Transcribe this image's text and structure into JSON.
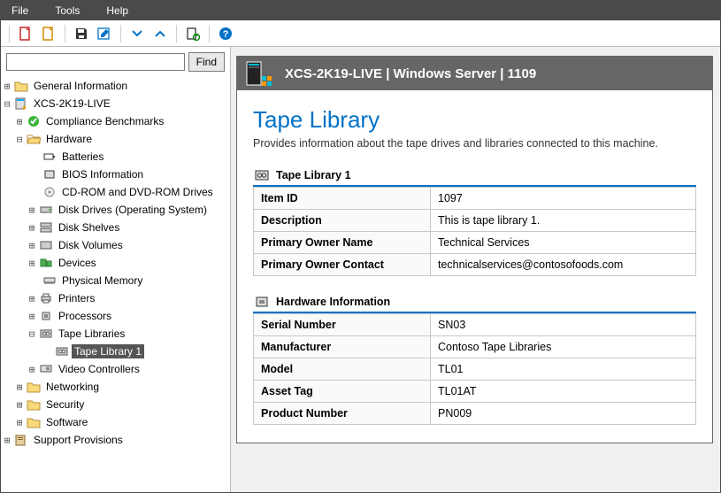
{
  "menu": {
    "file": "File",
    "tools": "Tools",
    "help": "Help"
  },
  "search": {
    "value": "",
    "placeholder": "",
    "button": "Find"
  },
  "tree": {
    "general": "General Information",
    "host": "XCS-2K19-LIVE",
    "compliance": "Compliance Benchmarks",
    "hardware": "Hardware",
    "batteries": "Batteries",
    "bios": "BIOS Information",
    "cdrom": "CD-ROM and DVD-ROM Drives",
    "disk_os": "Disk Drives (Operating System)",
    "disk_shelves": "Disk Shelves",
    "disk_volumes": "Disk Volumes",
    "devices": "Devices",
    "phys_mem": "Physical Memory",
    "printers": "Printers",
    "processors": "Processors",
    "tape_libraries": "Tape Libraries",
    "tape_library_1": "Tape Library 1",
    "video_controllers": "Video Controllers",
    "networking": "Networking",
    "security": "Security",
    "software": "Software",
    "support": "Support Provisions"
  },
  "header": {
    "title": "XCS-2K19-LIVE | Windows Server | 1109"
  },
  "page": {
    "title": "Tape Library",
    "description": "Provides information about the tape drives and libraries connected to this machine."
  },
  "sections": {
    "tape": {
      "title": "Tape Library 1",
      "rows": {
        "item_id": {
          "k": "Item ID",
          "v": "1097"
        },
        "description": {
          "k": "Description",
          "v": "This is tape library 1."
        },
        "owner_name": {
          "k": "Primary Owner Name",
          "v": "Technical Services"
        },
        "owner_contact": {
          "k": "Primary Owner Contact",
          "v": "technicalservices@contosofoods.com"
        }
      }
    },
    "hw": {
      "title": "Hardware Information",
      "rows": {
        "serial": {
          "k": "Serial Number",
          "v": "SN03"
        },
        "manufacturer": {
          "k": "Manufacturer",
          "v": "Contoso Tape Libraries"
        },
        "model": {
          "k": "Model",
          "v": "TL01"
        },
        "asset_tag": {
          "k": "Asset Tag",
          "v": "TL01AT"
        },
        "product_number": {
          "k": "Product Number",
          "v": "PN009"
        }
      }
    }
  }
}
